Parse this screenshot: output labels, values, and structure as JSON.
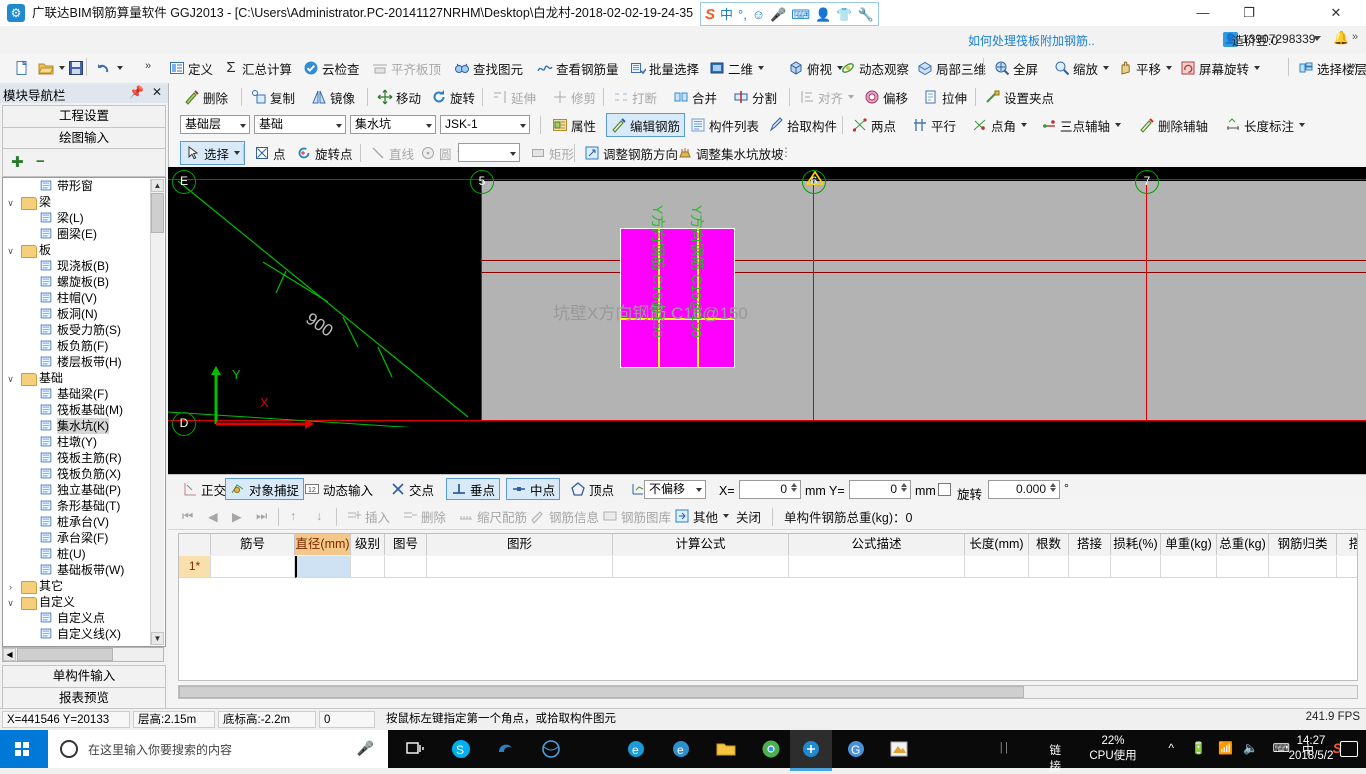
{
  "window": {
    "app_icon": "gld-icon",
    "title": "广联达BIM钢筋算量软件 GGJ2013 - [C:\\Users\\Administrator.PC-20141127NRHM\\Desktop\\白龙村-2018-02-02-19-24-35",
    "minimize": "—",
    "maximize": "❐",
    "close": "✕",
    "ime_items": [
      "中",
      "°,",
      "☺",
      "⬤",
      "⌨",
      "▤",
      "⬟",
      "⚒"
    ]
  },
  "account_bar": {
    "question": "如何处理筏板附加钢筋..",
    "user_icon": "user-icon",
    "phone": "13907298339",
    "beans": "造价豆:0",
    "bell": "🔔",
    "more": "»"
  },
  "toolbar_row1": {
    "left_items": [
      {
        "label": "",
        "icon": "new-file-icon"
      },
      {
        "label": "",
        "icon": "open-folder-icon",
        "caret": true
      },
      {
        "label": "",
        "icon": "save-icon"
      },
      {
        "label": "",
        "icon": "undo-icon",
        "caret": true
      }
    ],
    "overflow_left": "»",
    "items": [
      {
        "label": "定义",
        "icon": "define-icon"
      },
      {
        "label": "汇总计算",
        "icon": "sigma-icon"
      },
      {
        "label": "云检查",
        "icon": "cloud-check-icon"
      },
      {
        "label": "平齐板顶",
        "icon": "align-slab-icon",
        "disabled": true
      },
      {
        "label": "查找图元",
        "icon": "binoculars-icon"
      },
      {
        "label": "查看钢筋量",
        "icon": "view-rebar-icon"
      },
      {
        "label": "批量选择",
        "icon": "batch-select-icon"
      }
    ],
    "right_items": [
      {
        "label": "二维",
        "icon": "2d-icon",
        "caret": true
      },
      {
        "label": "俯视",
        "icon": "topview-icon",
        "caret": true
      },
      {
        "label": "动态观察",
        "icon": "orbit-icon"
      },
      {
        "label": "局部三维",
        "icon": "local3d-icon"
      },
      {
        "label": "全屏",
        "icon": "fullscreen-icon"
      },
      {
        "label": "缩放",
        "icon": "zoom-icon",
        "caret": true
      },
      {
        "label": "平移",
        "icon": "pan-icon",
        "caret": true
      },
      {
        "label": "屏幕旋转",
        "icon": "screen-rotate-icon",
        "caret": true
      },
      {
        "label": "选择楼层",
        "icon": "select-floor-icon"
      }
    ],
    "overflow_right": "»"
  },
  "toolbar_row2": {
    "items": [
      {
        "label": "删除",
        "icon": "delete-icon"
      },
      {
        "label": "复制",
        "icon": "copy-icon"
      },
      {
        "label": "镜像",
        "icon": "mirror-icon"
      },
      {
        "label": "移动",
        "icon": "move-icon"
      },
      {
        "label": "旋转",
        "icon": "rotate-icon"
      },
      {
        "label": "延伸",
        "icon": "extend-icon",
        "disabled": true
      },
      {
        "label": "修剪",
        "icon": "trim-icon",
        "disabled": true
      },
      {
        "label": "打断",
        "icon": "break-icon",
        "disabled": true
      },
      {
        "label": "合并",
        "icon": "merge-icon"
      },
      {
        "label": "分割",
        "icon": "split-icon"
      },
      {
        "label": "对齐",
        "icon": "align-icon",
        "disabled": true,
        "caret": true
      },
      {
        "label": "偏移",
        "icon": "offset-icon"
      },
      {
        "label": "拉伸",
        "icon": "stretch-icon"
      },
      {
        "label": "设置夹点",
        "icon": "set-grip-icon"
      }
    ]
  },
  "toolbar_row3": {
    "selects": [
      {
        "name": "floor",
        "value": "基础层"
      },
      {
        "name": "category",
        "value": "基础"
      },
      {
        "name": "component-type",
        "value": "集水坑"
      },
      {
        "name": "component",
        "value": "JSK-1"
      }
    ],
    "items": [
      {
        "label": "属性",
        "icon": "properties-icon"
      },
      {
        "label": "编辑钢筋",
        "icon": "edit-rebar-icon",
        "selected": true
      },
      {
        "label": "构件列表",
        "icon": "component-list-icon"
      },
      {
        "label": "拾取构件",
        "icon": "pick-component-icon"
      },
      {
        "label": "两点",
        "icon": "two-point-icon"
      },
      {
        "label": "平行",
        "icon": "parallel-icon"
      },
      {
        "label": "点角",
        "icon": "point-angle-icon",
        "caret": true
      },
      {
        "label": "三点辅轴",
        "icon": "three-point-axis-icon",
        "caret": true
      },
      {
        "label": "删除辅轴",
        "icon": "delete-axis-icon"
      },
      {
        "label": "长度标注",
        "icon": "length-dim-icon",
        "caret": true
      }
    ]
  },
  "toolbar_row4": {
    "items": [
      {
        "label": "选择",
        "icon": "cursor-icon",
        "selected": true,
        "caret": true
      },
      {
        "label": "点",
        "icon": "point-icon"
      },
      {
        "label": "旋转点",
        "icon": "rotate-point-icon"
      },
      {
        "label": "直线",
        "icon": "line-icon",
        "disabled": true
      },
      {
        "label": "圆",
        "icon": "circle-icon",
        "disabled": true,
        "caret": true
      },
      {
        "label": "矩形",
        "icon": "rect-icon",
        "disabled": true
      },
      {
        "label": "调整钢筋方向",
        "icon": "adjust-rebar-dir-icon"
      },
      {
        "label": "调整集水坑放坡",
        "icon": "adjust-pit-slope-icon"
      }
    ],
    "combo_value": ""
  },
  "nav_panel": {
    "title": "模块导航栏",
    "pin_icon": "pin-icon",
    "close_icon": "close-icon",
    "buttons": [
      "工程设置",
      "绘图输入"
    ],
    "tool_icons": [
      "expand-all-icon",
      "collapse-all-icon"
    ],
    "tree": [
      {
        "label": "带形窗",
        "depth": 2,
        "icon": "ribbon-window-icon"
      },
      {
        "label": "梁",
        "depth": 1,
        "icon": "folder-icon",
        "expander": "∨"
      },
      {
        "label": "梁(L)",
        "depth": 2,
        "icon": "beam-icon"
      },
      {
        "label": "圈梁(E)",
        "depth": 2,
        "icon": "ring-beam-icon"
      },
      {
        "label": "板",
        "depth": 1,
        "icon": "folder-icon",
        "expander": "∨"
      },
      {
        "label": "现浇板(B)",
        "depth": 2,
        "icon": "slab-icon"
      },
      {
        "label": "螺旋板(B)",
        "depth": 2,
        "icon": "spiral-slab-icon"
      },
      {
        "label": "柱帽(V)",
        "depth": 2,
        "icon": "column-cap-icon"
      },
      {
        "label": "板洞(N)",
        "depth": 2,
        "icon": "slab-hole-icon"
      },
      {
        "label": "板受力筋(S)",
        "depth": 2,
        "icon": "slab-rebar-icon"
      },
      {
        "label": "板负筋(F)",
        "depth": 2,
        "icon": "slab-neg-rebar-icon"
      },
      {
        "label": "楼层板带(H)",
        "depth": 2,
        "icon": "floor-band-icon"
      },
      {
        "label": "基础",
        "depth": 1,
        "icon": "folder-icon",
        "expander": "∨"
      },
      {
        "label": "基础梁(F)",
        "depth": 2,
        "icon": "found-beam-icon"
      },
      {
        "label": "筏板基础(M)",
        "depth": 2,
        "icon": "raft-found-icon"
      },
      {
        "label": "集水坑(K)",
        "depth": 2,
        "icon": "sump-pit-icon",
        "current": true
      },
      {
        "label": "柱墩(Y)",
        "depth": 2,
        "icon": "column-pier-icon"
      },
      {
        "label": "筏板主筋(R)",
        "depth": 2,
        "icon": "raft-main-rebar-icon"
      },
      {
        "label": "筏板负筋(X)",
        "depth": 2,
        "icon": "raft-neg-rebar-icon"
      },
      {
        "label": "独立基础(P)",
        "depth": 2,
        "icon": "iso-found-icon"
      },
      {
        "label": "条形基础(T)",
        "depth": 2,
        "icon": "strip-found-icon"
      },
      {
        "label": "桩承台(V)",
        "depth": 2,
        "icon": "pile-cap-icon"
      },
      {
        "label": "承台梁(F)",
        "depth": 2,
        "icon": "cap-beam-icon"
      },
      {
        "label": "桩(U)",
        "depth": 2,
        "icon": "pile-icon"
      },
      {
        "label": "基础板带(W)",
        "depth": 2,
        "icon": "found-band-icon"
      },
      {
        "label": "其它",
        "depth": 1,
        "icon": "folder-icon",
        "expander": "›"
      },
      {
        "label": "自定义",
        "depth": 1,
        "icon": "folder-icon",
        "expander": "∨"
      },
      {
        "label": "自定义点",
        "depth": 2,
        "icon": "custom-point-icon"
      },
      {
        "label": "自定义线(X)",
        "depth": 2,
        "icon": "custom-line-icon"
      }
    ],
    "bottom_buttons": [
      "单构件输入",
      "报表预览"
    ]
  },
  "canvas": {
    "axis_labels": [
      "E",
      "5",
      "6",
      "7",
      "D"
    ],
    "dimension": "900",
    "annotation_main": "坑壁X方向钢筋 C16@150",
    "annotation_v1": "Y方向钢筋 C16@150",
    "annotation_v2": "Y方向钢筋 C16@150",
    "ucs_x": "X",
    "ucs_y": "Y"
  },
  "snap_bar": {
    "toggles": [
      {
        "label": "正交",
        "icon": "ortho-icon",
        "on": false
      },
      {
        "label": "对象捕捉",
        "icon": "object-snap-icon",
        "on": true
      },
      {
        "label": "动态输入",
        "icon": "dynamic-input-icon",
        "on": false
      },
      {
        "label": "交点",
        "icon": "intersection-icon",
        "on": false
      },
      {
        "label": "垂点",
        "icon": "perpendicular-icon",
        "on": true
      },
      {
        "label": "中点",
        "icon": "midpoint-icon",
        "on": true
      },
      {
        "label": "顶点",
        "icon": "vertex-icon",
        "on": false
      },
      {
        "label": "坐标",
        "icon": "coordinate-icon",
        "on": false
      }
    ],
    "offset_mode": "不偏移",
    "x_label": "X=",
    "x_value": "0",
    "x_unit": "mm",
    "y_label": "Y=",
    "y_value": "0",
    "y_unit": "mm",
    "rotate_label": "旋转",
    "rotate_value": "0.000",
    "rotate_unit": "°"
  },
  "rebar_panel": {
    "nav_buttons": [
      "⏮",
      "◀",
      "▶",
      "⏭",
      "↑",
      "↓"
    ],
    "actions": [
      {
        "label": "插入",
        "icon": "insert-icon"
      },
      {
        "label": "删除",
        "icon": "delete-row-icon"
      },
      {
        "label": "缩尺配筋",
        "icon": "scale-rebar-icon"
      },
      {
        "label": "钢筋信息",
        "icon": "rebar-info-icon",
        "disabled": true
      },
      {
        "label": "钢筋图库",
        "icon": "rebar-library-icon",
        "disabled": true
      },
      {
        "label": "其他",
        "icon": "other-icon",
        "caret": true
      },
      {
        "label": "关闭",
        "icon": "close-panel-icon"
      }
    ],
    "total_label": "单构件钢筋总重(kg)：0",
    "columns": [
      "",
      "筋号",
      "直径(mm)",
      "级别",
      "图号",
      "图形",
      "计算公式",
      "公式描述",
      "长度(mm)",
      "根数",
      "搭接",
      "损耗(%)",
      "单重(kg)",
      "总重(kg)",
      "钢筋归类",
      "搭接形"
    ],
    "highlight_column": "直径(mm)",
    "rows": [
      {
        "index": "1*",
        "cells": [
          "",
          "",
          "",
          "",
          "",
          "",
          "",
          "",
          "",
          "",
          "",
          "",
          "",
          "",
          ""
        ]
      }
    ]
  },
  "status_bar": {
    "coords": "X=441546  Y=20133",
    "floor_height": "层高:2.15m",
    "base_elev": "底标高:-2.2m",
    "value": "0",
    "hint": "按鼠标左键指定第一个角点，或拾取构件图元",
    "fps": "241.9 FPS"
  },
  "taskbar": {
    "search_placeholder": "在这里输入你要搜索的内容",
    "apps": [
      "task-view-icon",
      "skype-icon",
      "edge-legacy-icon",
      "chrome-icon",
      "ie-icon",
      "edge-icon",
      "explorer-icon",
      "browser-icon",
      "gld-app-icon",
      "sogou-icon",
      "paint-icon"
    ],
    "tray_link": "链接",
    "cpu_percent": "22%",
    "cpu_label": "CPU使用",
    "tray_icons": [
      "chevron-up-icon",
      "battery-icon",
      "wifi-icon",
      "volume-icon",
      "keyboard-icon",
      "ime-cn-icon",
      "sogou-tray-icon"
    ],
    "time": "14:27",
    "date": "2018/5/2",
    "action_center": "notification-icon"
  }
}
